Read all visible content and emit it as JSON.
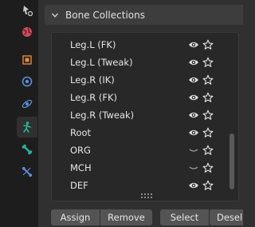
{
  "panel": {
    "title": "Bone Collections"
  },
  "tabs": [
    {
      "icon": "tool-settings-icon",
      "color": "#c8c8c8"
    },
    {
      "icon": "world-icon",
      "color": "#d84a5a"
    },
    {
      "icon": "object-icon",
      "color": "#e8893a"
    },
    {
      "icon": "modifier-icon",
      "color": "#5b8fd8"
    },
    {
      "icon": "physics-icon",
      "color": "#5b8fd8"
    },
    {
      "icon": "armature-data-icon",
      "color": "#1fb89a",
      "active": true
    },
    {
      "icon": "bone-icon",
      "color": "#1fb89a"
    },
    {
      "icon": "bone-constraint-icon",
      "color": "#5b8fd8"
    }
  ],
  "collections": [
    {
      "name": "Leg.L (FK)",
      "visible": true
    },
    {
      "name": "Leg.L (Tweak)",
      "visible": true
    },
    {
      "name": "Leg.R (IK)",
      "visible": true
    },
    {
      "name": "Leg.R (FK)",
      "visible": true
    },
    {
      "name": "Leg.R (Tweak)",
      "visible": true
    },
    {
      "name": "Root",
      "visible": true
    },
    {
      "name": "ORG",
      "visible": false
    },
    {
      "name": "MCH",
      "visible": false
    },
    {
      "name": "DEF",
      "visible": true
    }
  ],
  "buttons": {
    "assign": "Assign",
    "remove": "Remove",
    "select": "Select",
    "deselect": "Deselect"
  },
  "colors": {
    "panel_bg": "#303030",
    "list_bg": "#282828",
    "button_bg": "#545454",
    "active_tab_icon": "#1fb89a"
  }
}
